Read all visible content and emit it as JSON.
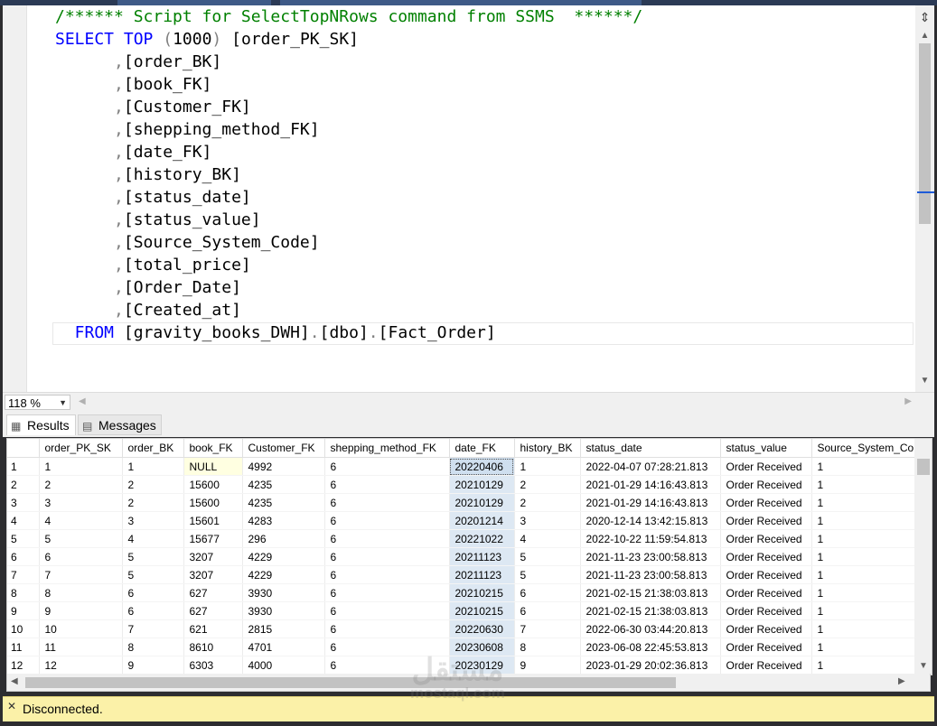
{
  "editor": {
    "lines": [
      [
        {
          "t": "/****** Script for SelectTopNRows command from SSMS  ******/",
          "c": "cm"
        }
      ],
      [
        {
          "t": "SELECT ",
          "c": "kw"
        },
        {
          "t": "TOP ",
          "c": "kw"
        },
        {
          "t": "(",
          "c": "gr"
        },
        {
          "t": "1000",
          "c": ""
        },
        {
          "t": ") ",
          "c": "gr"
        },
        {
          "t": "[order_PK_SK]",
          "c": ""
        }
      ],
      [
        {
          "t": "      ,",
          "c": "gr"
        },
        {
          "t": "[order_BK]",
          "c": ""
        }
      ],
      [
        {
          "t": "      ,",
          "c": "gr"
        },
        {
          "t": "[book_FK]",
          "c": ""
        }
      ],
      [
        {
          "t": "      ,",
          "c": "gr"
        },
        {
          "t": "[Customer_FK]",
          "c": ""
        }
      ],
      [
        {
          "t": "      ,",
          "c": "gr"
        },
        {
          "t": "[shepping_method_FK]",
          "c": ""
        }
      ],
      [
        {
          "t": "      ,",
          "c": "gr"
        },
        {
          "t": "[date_FK]",
          "c": ""
        }
      ],
      [
        {
          "t": "      ,",
          "c": "gr"
        },
        {
          "t": "[history_BK]",
          "c": ""
        }
      ],
      [
        {
          "t": "      ,",
          "c": "gr"
        },
        {
          "t": "[status_date]",
          "c": ""
        }
      ],
      [
        {
          "t": "      ,",
          "c": "gr"
        },
        {
          "t": "[status_value]",
          "c": ""
        }
      ],
      [
        {
          "t": "      ,",
          "c": "gr"
        },
        {
          "t": "[Source_System_Code]",
          "c": ""
        }
      ],
      [
        {
          "t": "      ,",
          "c": "gr"
        },
        {
          "t": "[total_price]",
          "c": ""
        }
      ],
      [
        {
          "t": "      ,",
          "c": "gr"
        },
        {
          "t": "[Order_Date]",
          "c": ""
        }
      ],
      [
        {
          "t": "      ,",
          "c": "gr"
        },
        {
          "t": "[Created_at]",
          "c": ""
        }
      ],
      [
        {
          "t": "  FROM ",
          "c": "kw"
        },
        {
          "t": "[gravity_books_DWH]",
          "c": ""
        },
        {
          "t": ".",
          "c": "gr"
        },
        {
          "t": "[dbo]",
          "c": ""
        },
        {
          "t": ".",
          "c": "gr"
        },
        {
          "t": "[Fact_Order]",
          "c": ""
        }
      ]
    ]
  },
  "zoom": {
    "value": "118 %"
  },
  "tabs": {
    "results": "Results",
    "messages": "Messages"
  },
  "grid": {
    "columns": [
      "order_PK_SK",
      "order_BK",
      "book_FK",
      "Customer_FK",
      "shepping_method_FK",
      "date_FK",
      "history_BK",
      "status_date",
      "status_value",
      "Source_System_Co"
    ],
    "rows": [
      [
        "1",
        "1",
        "1",
        "NULL",
        "4992",
        "6",
        "20220406",
        "1",
        "2022-04-07 07:28:21.813",
        "Order Received",
        "1"
      ],
      [
        "2",
        "2",
        "2",
        "15600",
        "4235",
        "6",
        "20210129",
        "2",
        "2021-01-29 14:16:43.813",
        "Order Received",
        "1"
      ],
      [
        "3",
        "3",
        "2",
        "15600",
        "4235",
        "6",
        "20210129",
        "2",
        "2021-01-29 14:16:43.813",
        "Order Received",
        "1"
      ],
      [
        "4",
        "4",
        "3",
        "15601",
        "4283",
        "6",
        "20201214",
        "3",
        "2020-12-14 13:42:15.813",
        "Order Received",
        "1"
      ],
      [
        "5",
        "5",
        "4",
        "15677",
        "296",
        "6",
        "20221022",
        "4",
        "2022-10-22 11:59:54.813",
        "Order Received",
        "1"
      ],
      [
        "6",
        "6",
        "5",
        "3207",
        "4229",
        "6",
        "20211123",
        "5",
        "2021-11-23 23:00:58.813",
        "Order Received",
        "1"
      ],
      [
        "7",
        "7",
        "5",
        "3207",
        "4229",
        "6",
        "20211123",
        "5",
        "2021-11-23 23:00:58.813",
        "Order Received",
        "1"
      ],
      [
        "8",
        "8",
        "6",
        "627",
        "3930",
        "6",
        "20210215",
        "6",
        "2021-02-15 21:38:03.813",
        "Order Received",
        "1"
      ],
      [
        "9",
        "9",
        "6",
        "627",
        "3930",
        "6",
        "20210215",
        "6",
        "2021-02-15 21:38:03.813",
        "Order Received",
        "1"
      ],
      [
        "10",
        "10",
        "7",
        "621",
        "2815",
        "6",
        "20220630",
        "7",
        "2022-06-30 03:44:20.813",
        "Order Received",
        "1"
      ],
      [
        "11",
        "11",
        "8",
        "8610",
        "4701",
        "6",
        "20230608",
        "8",
        "2023-06-08 22:45:53.813",
        "Order Received",
        "1"
      ],
      [
        "12",
        "12",
        "9",
        "6303",
        "4000",
        "6",
        "20230129",
        "9",
        "2023-01-29 20:02:36.813",
        "Order Received",
        "1"
      ]
    ]
  },
  "status": {
    "text": "Disconnected."
  },
  "watermark": {
    "arabic": "مستقل",
    "latin": "mostaql.com"
  }
}
